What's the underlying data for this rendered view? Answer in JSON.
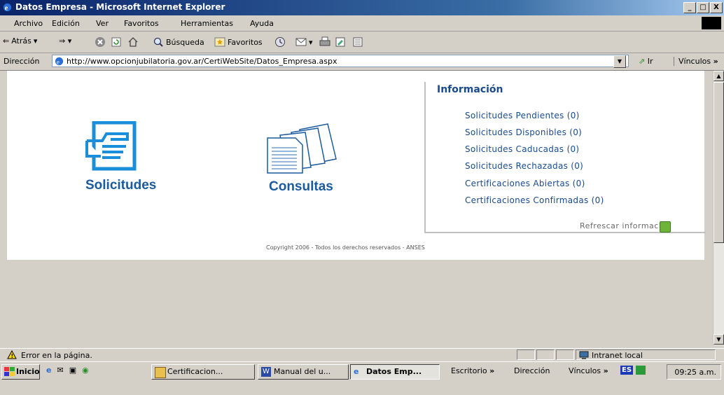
{
  "window": {
    "title": "Datos Empresa - Microsoft Internet Explorer",
    "buttons": [
      "_",
      "□",
      "X"
    ]
  },
  "menubar": [
    "Archivo",
    "Edición",
    "Ver",
    "Favoritos",
    "Herramientas",
    "Ayuda"
  ],
  "toolbar": {
    "back": "Atrás",
    "search": "Búsqueda",
    "favorites": "Favoritos"
  },
  "address": {
    "label": "Dirección",
    "url": "http://www.opcionjubilatoria.gov.ar/CertiWebSite/Datos_Empresa.aspx",
    "go": "Ir",
    "links": "Vínculos"
  },
  "page": {
    "solicitudes": "Solicitudes",
    "consultas": "Consultas",
    "info_title": "Información",
    "info_items": [
      "Solicitudes Pendientes (0)",
      "Solicitudes Disponibles (0)",
      "Solicitudes Caducadas (0)",
      "Solicitudes Rechazadas (0)",
      "Certificaciones Abiertas (0)",
      "Certificaciones Confirmadas (0)"
    ],
    "refresh": "Refrescar información",
    "copyright": "Copyright 2006 - Todos los derechos reservados - ANSES"
  },
  "status": {
    "message": "Error en la página.",
    "zone": "Intranet local"
  },
  "taskbar": {
    "start": "Inicio",
    "tasks": [
      "Certificacion...",
      "Manual del u...",
      "Datos Emp..."
    ],
    "desktop": "Escritorio",
    "address": "Dirección",
    "links": "Vínculos",
    "lang": "ES",
    "clock": "09:25 a.m."
  },
  "colors": {
    "link": "#1a4a8e",
    "title_gradient_start": "#0a246a"
  }
}
